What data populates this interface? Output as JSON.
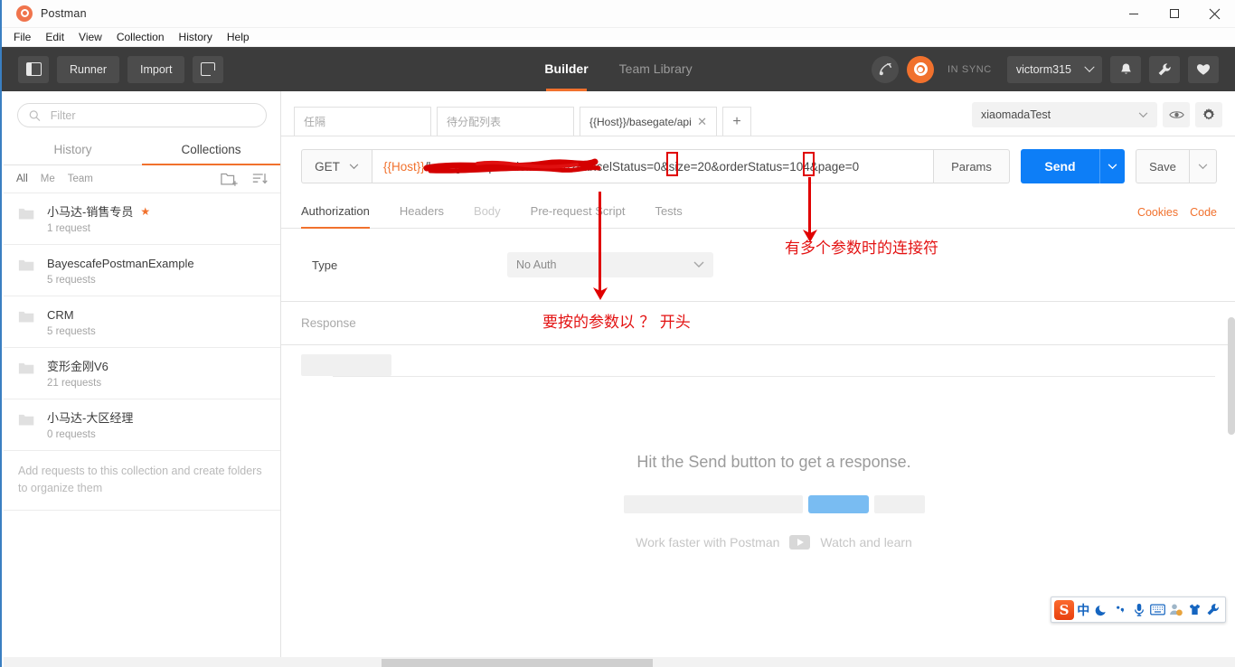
{
  "window": {
    "app_title": "Postman",
    "minimize_label": "Minimize",
    "maximize_label": "Maximize",
    "close_label": "Close"
  },
  "menubar": {
    "items": [
      "File",
      "Edit",
      "View",
      "Collection",
      "History",
      "Help"
    ]
  },
  "toolbar": {
    "sidebar_toggle_label": "sidebar-toggle",
    "runner_label": "Runner",
    "import_label": "Import",
    "new_tab_label": "New",
    "center_tabs": [
      {
        "label": "Builder",
        "active": true
      },
      {
        "label": "Team Library",
        "active": false
      }
    ],
    "sync_status": "IN SYNC",
    "user_name": "victorm315",
    "bell_label": "Notifications",
    "wrench_label": "Settings",
    "heart_label": "Favorites"
  },
  "sidebar": {
    "filter": {
      "placeholder": "Filter",
      "value": ""
    },
    "tabs": [
      {
        "label": "History",
        "active": false
      },
      {
        "label": "Collections",
        "active": true
      }
    ],
    "scope_filters": [
      {
        "label": "All",
        "active": true
      },
      {
        "label": "Me",
        "active": false
      },
      {
        "label": "Team",
        "active": false
      }
    ],
    "new_folder_label": "New folder",
    "sort_label": "Sort",
    "collections": [
      {
        "name": "小马达-销售专员",
        "requests": "1 request",
        "starred": true
      },
      {
        "name": "BayescafePostmanExample",
        "requests": "5 requests",
        "starred": false
      },
      {
        "name": "CRM",
        "requests": "5 requests",
        "starred": false
      },
      {
        "name": "变形金刚V6",
        "requests": "21 requests",
        "starred": false
      },
      {
        "name": "小马达-大区经理",
        "requests": "0 requests",
        "starred": false
      }
    ],
    "empty_note": "Add requests to this collection and create folders to organize them"
  },
  "request_tabs": {
    "tabs": [
      {
        "label": "任隔",
        "active": false,
        "closable": false
      },
      {
        "label": "待分配列表",
        "active": false,
        "closable": false
      },
      {
        "label": "{{Host}}/basegate/api",
        "active": true,
        "closable": true
      }
    ],
    "add_tab_label": "+"
  },
  "environment": {
    "selected": "xiaomadaTest",
    "eye_label": "Environment quick look",
    "gear_label": "Manage environments"
  },
  "url_bar": {
    "method": "GET",
    "url_prefix": "{{Host}}",
    "url_redacted": "/basegate/api/order/",
    "url_visible": "search?cancelStatus=0&size=20&orderStatus=104&page=0",
    "full_url": "{{Host}}/basegate/api/order/search?cancelStatus=0&size=20&orderStatus=104&page=0",
    "params_label": "Params",
    "send_label": "Send",
    "send_caret_label": "Send options",
    "save_label": "Save",
    "save_caret_label": "Save options"
  },
  "request_subtabs": {
    "tabs": [
      {
        "label": "Authorization",
        "active": true,
        "dim": false
      },
      {
        "label": "Headers",
        "active": false,
        "dim": false
      },
      {
        "label": "Body",
        "active": false,
        "dim": true
      },
      {
        "label": "Pre-request Script",
        "active": false,
        "dim": false
      },
      {
        "label": "Tests",
        "active": false,
        "dim": false
      }
    ],
    "cookies_label": "Cookies",
    "code_label": "Code"
  },
  "auth": {
    "type_label": "Type",
    "type_value": "No Auth"
  },
  "response": {
    "label": "Response",
    "empty_title": "Hit the Send button to get a response.",
    "work_faster": "Work faster with Postman",
    "watch_learn": "Watch and learn",
    "play_label": "play-video"
  },
  "annotations": [
    {
      "id": "qmark",
      "text": "要按的参数以 ？ 开头",
      "target": "question-mark-in-url",
      "color": "#e31212"
    },
    {
      "id": "amp",
      "text": "有多个参数时的连接符",
      "target": "ampersand-in-url",
      "color": "#e31212"
    }
  ],
  "ime": {
    "name": "sogou-input-method",
    "logo": "S",
    "mode": "中",
    "items": [
      "moon-icon",
      "comma-icon",
      "mic-icon",
      "keyboard-icon",
      "user-icon",
      "skin-icon",
      "tools-icon"
    ]
  }
}
